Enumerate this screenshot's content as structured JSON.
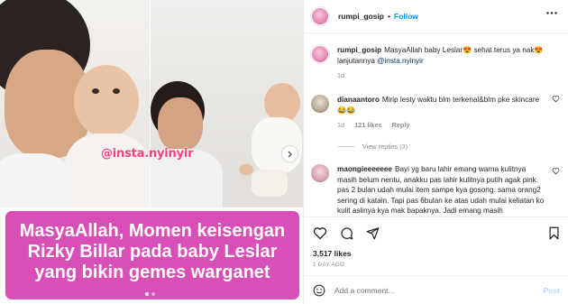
{
  "media": {
    "watermark": "@insta.nyinyir",
    "caption_overlay": "MasyaAllah, Momen keisengan Rizky Billar pada baby Leslar yang bikin gemes warganet",
    "carousel": {
      "count": 2,
      "active": 0
    },
    "icons": {
      "next": "chevron-right-icon"
    }
  },
  "header": {
    "username": "rumpi_gosip",
    "separator": "•",
    "follow_label": "Follow",
    "icons": {
      "more": "more-horizontal-icon"
    }
  },
  "caption": {
    "username": "rumpi_gosip",
    "text": "MasyaAllah baby Leslar😍 sehat terus ya nak😍 lanjutannya ",
    "mention": "@insta.nyinyir",
    "time": "1d"
  },
  "comments": [
    {
      "username": "dianaantoro",
      "text": "Mirip lesty waktu blm terkenal&blm pke skincare 😂😂",
      "time": "1d",
      "likes": "121 likes",
      "reply_label": "Reply",
      "view_replies": "View replies (3)"
    },
    {
      "username": "maongieeeeeee",
      "text": "Bayi yg baru lahir emang warna kulitnya masih belum nentu, anakku pas lahir kulitnya putih agak pink. pas 2 bulan udah mulai item sampe kya gosong. sama orang2 sering di katain. Tapi pas 6bulan ke atas udah mulai keliatan ko kulit aslinya kya mak bapaknya. Jadi emang masih menyesuaikan."
    }
  ],
  "actions": {
    "likes": "3,517 likes",
    "timestamp": "1 DAY AGO",
    "add_comment_placeholder": "Add a comment...",
    "post_label": "Post",
    "icons": {
      "like": "heart-icon",
      "comment": "comment-icon",
      "share": "share-icon",
      "save": "bookmark-icon",
      "emoji": "emoji-icon"
    }
  },
  "colors": {
    "link": "#0095f6",
    "mention": "#00376b",
    "banner": "#d94fb8",
    "watermark": "#ff3f7a",
    "muted": "#8e8e8e"
  }
}
